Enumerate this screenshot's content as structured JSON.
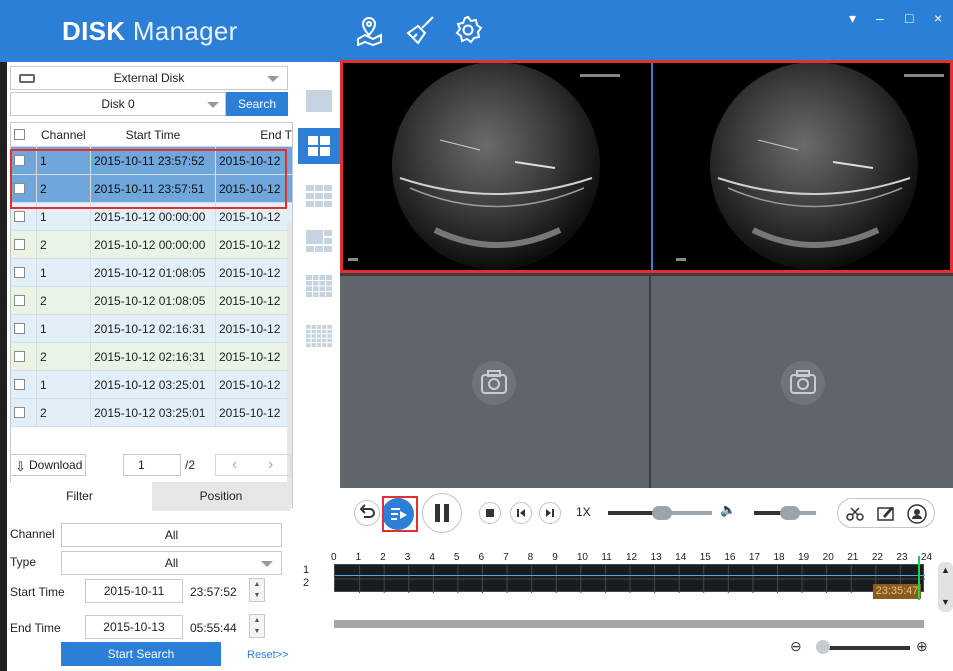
{
  "app": {
    "title_bold": "DISK",
    "title_rest": " Manager"
  },
  "top_icons": [
    "map-icon",
    "broom-icon",
    "settings-gear-icon"
  ],
  "window_controls": {
    "dropdown": "▾",
    "minimize": "–",
    "maximize": "□",
    "close": "×"
  },
  "disk_source": {
    "value": "External Disk"
  },
  "disk_select": {
    "value": "Disk 0"
  },
  "search_button": "Search",
  "table": {
    "headers": [
      "Channel",
      "Start Time",
      "End T"
    ],
    "rows": [
      {
        "channel": "1",
        "start": "2015-10-11 23:57:52",
        "end": "2015-10-12"
      },
      {
        "channel": "2",
        "start": "2015-10-11 23:57:51",
        "end": "2015-10-12"
      },
      {
        "channel": "1",
        "start": "2015-10-12 00:00:00",
        "end": "2015-10-12"
      },
      {
        "channel": "2",
        "start": "2015-10-12 00:00:00",
        "end": "2015-10-12"
      },
      {
        "channel": "1",
        "start": "2015-10-12 01:08:05",
        "end": "2015-10-12"
      },
      {
        "channel": "2",
        "start": "2015-10-12 01:08:05",
        "end": "2015-10-12"
      },
      {
        "channel": "1",
        "start": "2015-10-12 02:16:31",
        "end": "2015-10-12"
      },
      {
        "channel": "2",
        "start": "2015-10-12 02:16:31",
        "end": "2015-10-12"
      },
      {
        "channel": "1",
        "start": "2015-10-12 03:25:01",
        "end": "2015-10-12"
      },
      {
        "channel": "2",
        "start": "2015-10-12 03:25:01",
        "end": "2015-10-12"
      }
    ]
  },
  "pager": {
    "download": "Download",
    "page": "1",
    "total": "/2",
    "prev": "‹",
    "next": "›"
  },
  "tabs": {
    "filter": "Filter",
    "position": "Position"
  },
  "filter": {
    "channel_label": "Channel",
    "channel_value": "All",
    "type_label": "Type",
    "type_value": "All",
    "start_label": "Start Time",
    "start_date": "2015-10-11",
    "start_time": "23:57:52",
    "end_label": "End Time",
    "end_date": "2015-10-13",
    "end_time": "05:55:44",
    "start_search": "Start Search",
    "reset": "Reset>>"
  },
  "playback": {
    "speed": "1X"
  },
  "timeline": {
    "hours": [
      "0",
      "1",
      "2",
      "3",
      "4",
      "5",
      "6",
      "7",
      "8",
      "9",
      "10",
      "11",
      "12",
      "13",
      "14",
      "15",
      "16",
      "17",
      "18",
      "19",
      "20",
      "21",
      "22",
      "23",
      "24"
    ],
    "channels": [
      "1",
      "2"
    ],
    "current_time": "23:35:47"
  },
  "colors": {
    "accent": "#2b7fd6",
    "selection": "#6fa6db",
    "highlight_red": "#e03030"
  }
}
